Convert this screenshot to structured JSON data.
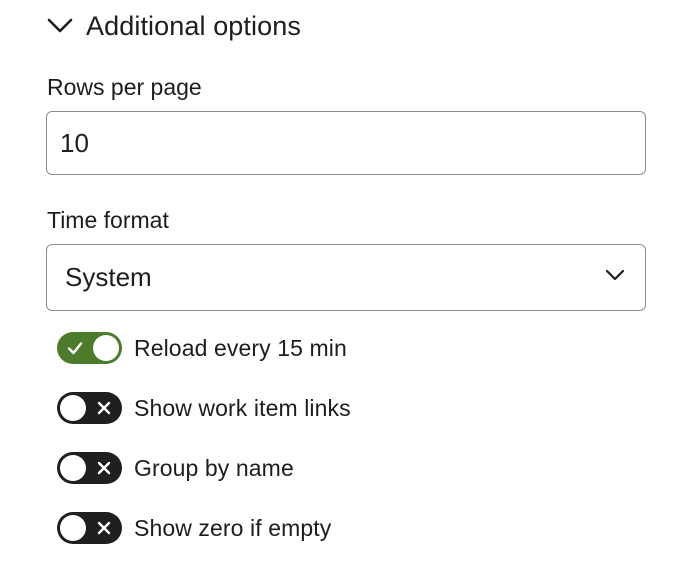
{
  "section": {
    "title": "Additional options",
    "expanded": true,
    "icon": "chevron-down-icon"
  },
  "rows_per_page": {
    "label": "Rows per page",
    "value": "10"
  },
  "time_format": {
    "label": "Time format",
    "value": "System",
    "icon": "chevron-down-icon"
  },
  "toggles": [
    {
      "label": "Reload every 15 min",
      "checked": true,
      "icon": "check-icon"
    },
    {
      "label": "Show work item links",
      "checked": false,
      "icon": "x-icon"
    },
    {
      "label": "Group by name",
      "checked": false,
      "icon": "x-icon"
    },
    {
      "label": "Show zero if empty",
      "checked": false,
      "icon": "x-icon"
    }
  ],
  "colors": {
    "toggle_on": "#4b7b2b",
    "toggle_off": "#1f1f1f",
    "input_border": "#8e8e8e",
    "text": "#1d1d1f"
  }
}
